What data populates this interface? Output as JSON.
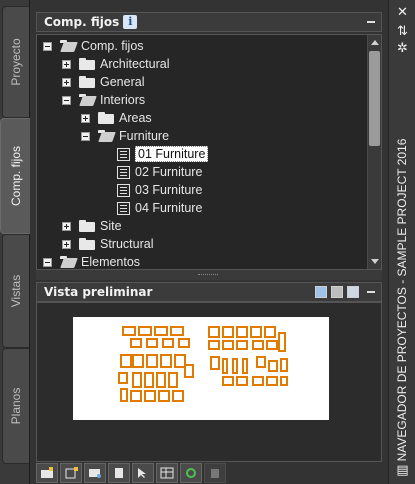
{
  "left_tabs": [
    {
      "label": "Proyecto"
    },
    {
      "label": "Comp. fijos"
    },
    {
      "label": "Vistas"
    },
    {
      "label": "Planos"
    }
  ],
  "components_panel": {
    "title": "Comp. fijos",
    "info_icon": "i",
    "tree": [
      {
        "label": "Comp. fijos",
        "state": "expanded",
        "type": "folder-open",
        "selected": false
      },
      {
        "label": "Architectural",
        "state": "collapsed",
        "type": "folder",
        "selected": false
      },
      {
        "label": "General",
        "state": "collapsed",
        "type": "folder",
        "selected": false
      },
      {
        "label": "Interiors",
        "state": "expanded",
        "type": "folder-open",
        "selected": false
      },
      {
        "label": "Areas",
        "state": "collapsed",
        "type": "folder",
        "selected": false
      },
      {
        "label": "Furniture",
        "state": "expanded",
        "type": "folder-open",
        "selected": false
      },
      {
        "label": "01 Furniture",
        "state": "leaf",
        "type": "component",
        "selected": true
      },
      {
        "label": "02 Furniture",
        "state": "leaf",
        "type": "component",
        "selected": false
      },
      {
        "label": "03 Furniture",
        "state": "leaf",
        "type": "component",
        "selected": false
      },
      {
        "label": "04 Furniture",
        "state": "leaf",
        "type": "component",
        "selected": false
      },
      {
        "label": "Site",
        "state": "collapsed",
        "type": "folder",
        "selected": false
      },
      {
        "label": "Structural",
        "state": "collapsed",
        "type": "folder",
        "selected": false
      },
      {
        "label": "Elementos",
        "state": "expanded",
        "type": "folder-open",
        "selected": false
      }
    ]
  },
  "preview_panel": {
    "title": "Vista preliminar"
  },
  "right_bar": {
    "title": "NAVEGADOR DE PROYECTOS - SAMPLE PROJECT 2016",
    "icons": [
      "close-icon",
      "autohide-icon",
      "properties-icon",
      "menu-icon"
    ]
  },
  "toolbar": {
    "buttons": [
      "add-folder-icon",
      "add-component-icon",
      "open-icon",
      "document-icon",
      "select-icon",
      "table-icon",
      "refresh-icon",
      "delete-icon"
    ]
  },
  "colors": {
    "panel_bg": "#333333",
    "tree_bg": "#262626",
    "drawing_orange": "#e07b00"
  }
}
